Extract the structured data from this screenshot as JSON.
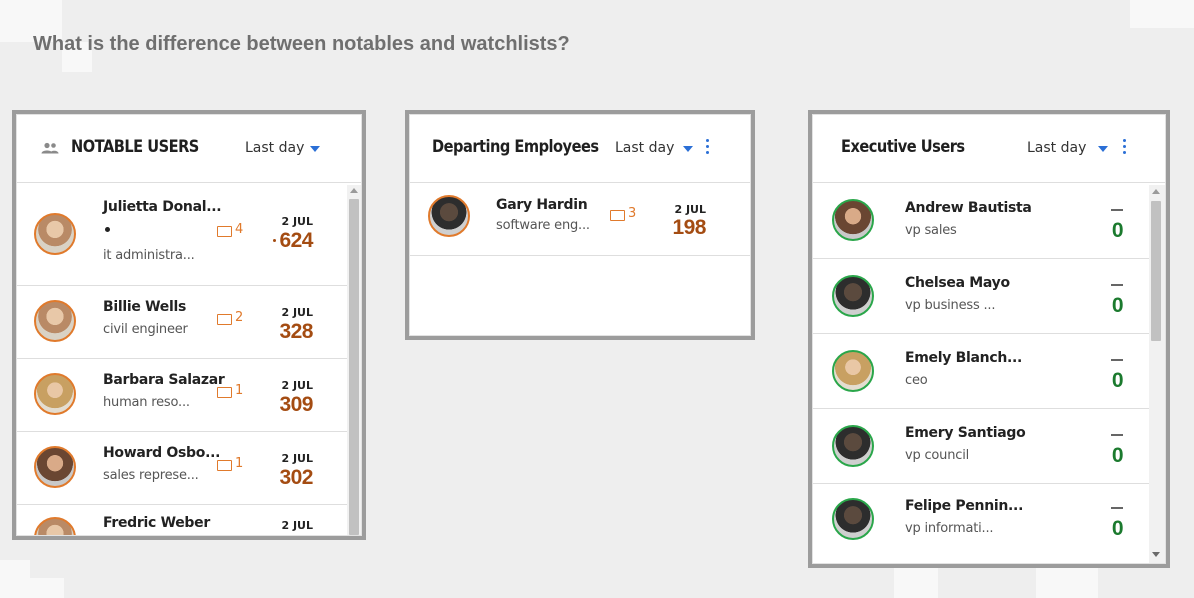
{
  "question": "What is the difference between notables and watchlists?",
  "notable": {
    "title": "NOTABLE USERS",
    "period": "Last day",
    "users": [
      {
        "name": "Julietta Donal...",
        "role": "it administra...",
        "files": "4",
        "date": "2 JUL",
        "score": "624"
      },
      {
        "name": "Billie Wells",
        "role": "civil engineer",
        "files": "2",
        "date": "2 JUL",
        "score": "328"
      },
      {
        "name": "Barbara Salazar",
        "role": "human reso...",
        "files": "1",
        "date": "2 JUL",
        "score": "309"
      },
      {
        "name": "Howard Osbo...",
        "role": "sales represe...",
        "files": "1",
        "date": "2 JUL",
        "score": "302"
      },
      {
        "name": "Fredric Weber",
        "date": "2 JUL"
      }
    ]
  },
  "departing": {
    "title": "Departing Employees",
    "period": "Last day",
    "users": [
      {
        "name": "Gary Hardin",
        "role": "software eng...",
        "files": "3",
        "date": "2 JUL",
        "score": "198"
      }
    ]
  },
  "executive": {
    "title": "Executive Users",
    "period": "Last day",
    "users": [
      {
        "name": "Andrew Bautista",
        "role": "vp sales",
        "score": "0"
      },
      {
        "name": "Chelsea Mayo",
        "role": "vp business ...",
        "score": "0"
      },
      {
        "name": "Emely Blanch...",
        "role": "ceo",
        "score": "0"
      },
      {
        "name": "Emery Santiago",
        "role": "vp council",
        "score": "0"
      },
      {
        "name": "Felipe Pennin...",
        "role": "vp informati...",
        "score": "0"
      }
    ]
  },
  "colors": {
    "accent": "#2b6fd6",
    "risk": "#a44c12",
    "folder": "#e07a2c",
    "safe": "#1b7a2e"
  },
  "icons": {
    "notable_header": "people-icon",
    "folder": "folder-icon",
    "menu": "kebab-menu-icon",
    "dropdown": "caret-down-icon"
  }
}
